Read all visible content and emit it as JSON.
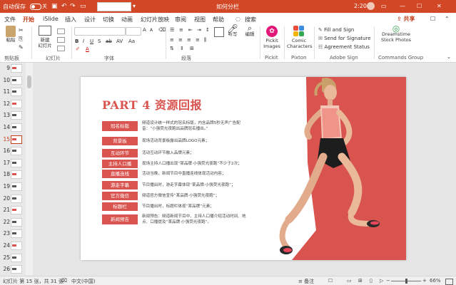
{
  "title_bar": {
    "autosave_label": "自动保存",
    "autosave_state": "关",
    "doc_title": "如何分栏",
    "time": "2:20"
  },
  "tabs": [
    "文件",
    "开始",
    "iSlide",
    "插入",
    "设计",
    "切换",
    "动画",
    "幻灯片放映",
    "审阅",
    "视图",
    "帮助"
  ],
  "active_tab": "开始",
  "search_label": "搜索",
  "share_label": "共享",
  "ribbon": {
    "paste_label": "粘贴",
    "new_slide_label": "新建\n幻灯片",
    "voice_label": "听写",
    "edit_label": "编辑",
    "picklt_label": "Pickit\nImages",
    "comic_label": "Comic\nCharacters",
    "fill_sign": "Fill and Sign",
    "send_sig": "Send for Signature",
    "agreement": "Agreement Status",
    "dreamstime": "Dreamstime\nStock Photos",
    "groups": [
      "剪贴板",
      "幻灯片",
      "字体",
      "段落",
      "Pickit",
      "Pixton",
      "Adobe Sign",
      "Commands Group"
    ]
  },
  "thumbnails": [
    "9",
    "10",
    "11",
    "12",
    "13",
    "14",
    "15",
    "16",
    "17",
    "18",
    "19",
    "20",
    "21",
    "22",
    "23",
    "24",
    "25",
    "26"
  ],
  "selected_slide": "15",
  "slide": {
    "title": "PART 4  资源回报",
    "rows": [
      {
        "label": "冠名标版",
        "desc": "频道设计统一样式的冠名标版，内含品牌5秒无声广告配音：“小强荧光夜跑出品牌冠名播出。”"
      },
      {
        "label": "背景板",
        "desc": "现场活动背景板露出品牌LOGO元素；"
      },
      {
        "label": "互动环节",
        "desc": "活动互动环节融入品牌元素；"
      },
      {
        "label": "主持人口播",
        "desc": "现场主持人口播出现“某品牌·小强荧光夜跑”不少于2次；"
      },
      {
        "label": "直播连线",
        "desc": "活动当晚，新闻节目中直播连线体现活动内容；"
      },
      {
        "label": "游走字幕",
        "desc": "节目播出时，游走字幕体现“某品牌·小强荧光夜跑”；"
      },
      {
        "label": "官方微信",
        "desc": "频道官方微信宣传“某品牌·小强荧光夜跑”；"
      },
      {
        "label": "标题栏",
        "desc": "节目播出时，标题栏体现“某品牌”元素；"
      },
      {
        "label": "新闻预告",
        "desc": "新闻预告：频道新闻节目中，主持人口播介绍活动时间、地点、口播提及“某品牌·小强荧光夜跑”。"
      }
    ]
  },
  "status": {
    "slide_info": "幻灯片 第 15 张，共 31 张",
    "language": "中文(中国)",
    "notes_label": "备注",
    "zoom": "66%"
  },
  "colors": {
    "accent": "#d24726",
    "slide_red": "#d9534f"
  }
}
